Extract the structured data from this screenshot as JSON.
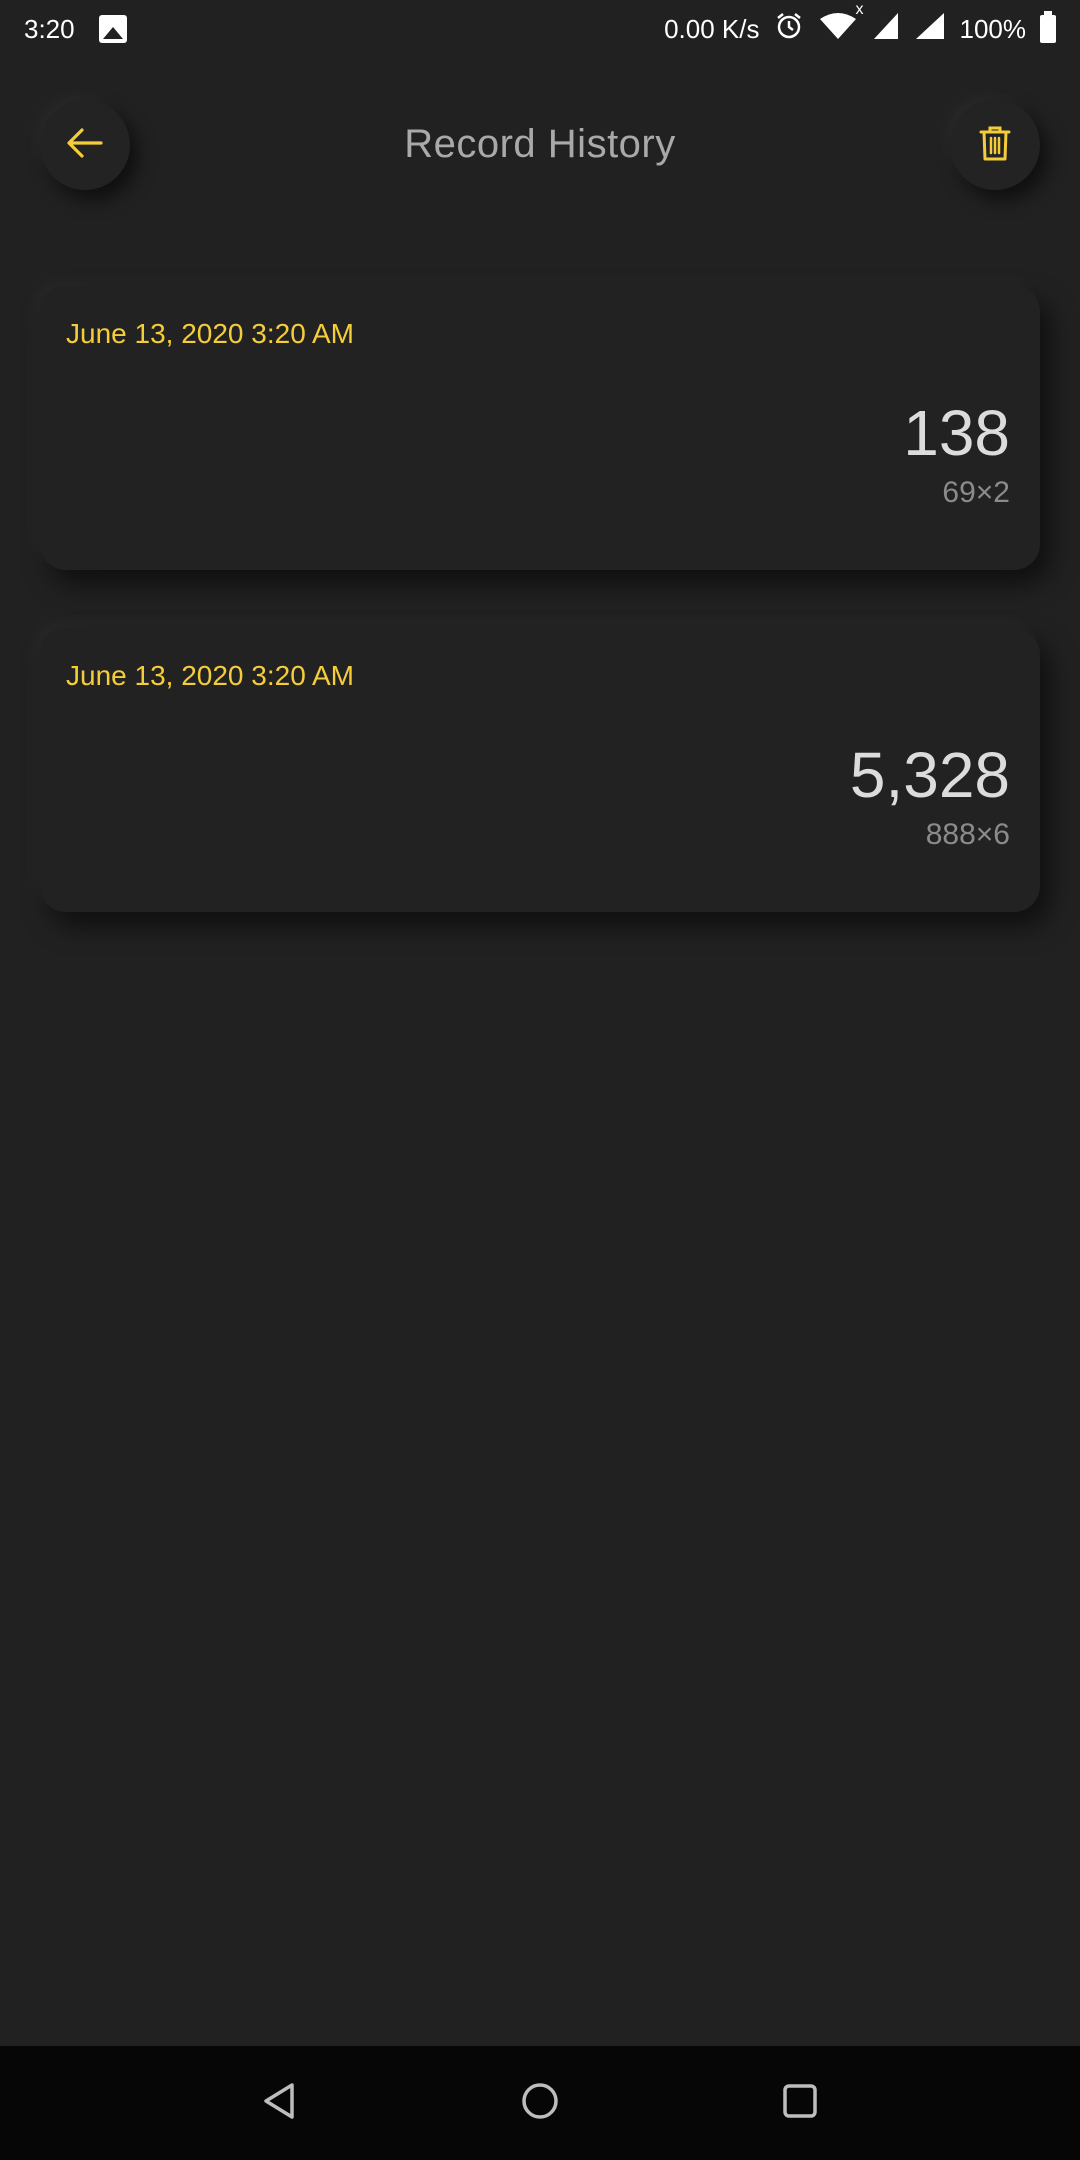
{
  "status_bar": {
    "time": "3:20",
    "network_speed": "0.00 K/s",
    "battery": "100%",
    "wifi_badge": "x"
  },
  "header": {
    "title": "Record History",
    "accent_color": "#f5cd3a"
  },
  "records": [
    {
      "date": "June 13, 2020 3:20 AM",
      "result": "138",
      "expression": "69×2"
    },
    {
      "date": "June 13, 2020 3:20 AM",
      "result": "5,328",
      "expression": "888×6"
    }
  ],
  "colors": {
    "background": "#212121",
    "accent": "#f5cd3a",
    "title": "#a9a9a9",
    "result": "#dcdcdc",
    "expression": "#8b8b8b",
    "nav_bar": "#060606"
  },
  "icons": {
    "back": "arrow-left-icon",
    "delete": "trash-icon",
    "nav_back": "triangle-back-icon",
    "nav_home": "circle-home-icon",
    "nav_recents": "square-recents-icon"
  }
}
